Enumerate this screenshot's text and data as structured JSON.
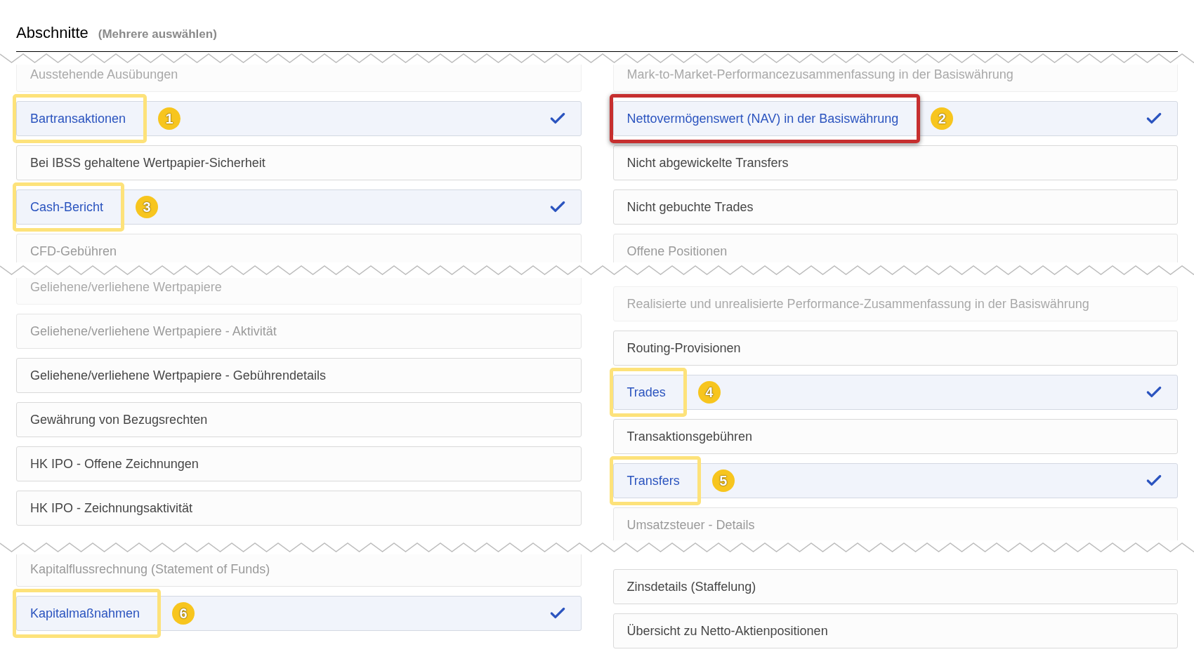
{
  "header": {
    "title": "Abschnitte",
    "hint": "(Mehrere auswählen)"
  },
  "segments": [
    {
      "columns": [
        [
          {
            "label": "Ausstehende Ausübungen",
            "selected": false,
            "kind": "faint"
          },
          {
            "label": "Bartransaktionen",
            "selected": true,
            "kind": "normal",
            "callout": {
              "number": "1",
              "color": "#fde27a"
            }
          },
          {
            "label": "Bei IBSS gehaltene Wertpapier-Sicherheit",
            "selected": false,
            "kind": "normal"
          },
          {
            "label": "Cash-Bericht",
            "selected": true,
            "kind": "normal",
            "callout": {
              "number": "3",
              "color": "#fde27a"
            }
          },
          {
            "label": "CFD-Gebühren",
            "selected": false,
            "kind": "muted"
          }
        ],
        [
          {
            "label": "Mark-to-Market-Performancezusammenfassung in der Basiswährung",
            "selected": false,
            "kind": "faint"
          },
          {
            "label": "Nettovermögenswert (NAV) in der Basiswährung",
            "selected": true,
            "kind": "normal",
            "callout": {
              "number": "2",
              "color": "#c62f2f"
            }
          },
          {
            "label": "Nicht abgewickelte Transfers",
            "selected": false,
            "kind": "normal"
          },
          {
            "label": "Nicht gebuchte Trades",
            "selected": false,
            "kind": "normal"
          },
          {
            "label": "Offene Positionen",
            "selected": false,
            "kind": "muted"
          }
        ]
      ]
    },
    {
      "columns": [
        [
          {
            "label": "Geliehene/verliehene Wertpapiere",
            "selected": false,
            "kind": "faint"
          },
          {
            "label": "Geliehene/verliehene Wertpapiere - Aktivität",
            "selected": false,
            "kind": "muted"
          },
          {
            "label": "Geliehene/verliehene Wertpapiere - Gebührendetails",
            "selected": false,
            "kind": "normal"
          },
          {
            "label": "Gewährung von Bezugsrechten",
            "selected": false,
            "kind": "normal"
          },
          {
            "label": "HK IPO - Offene Zeichnungen",
            "selected": false,
            "kind": "normal"
          },
          {
            "label": "HK IPO - Zeichnungsaktivität",
            "selected": false,
            "kind": "normal"
          }
        ],
        [
          {
            "label": "Realisierte und unrealisierte Performance-Zusammenfassung in der Basiswährung",
            "selected": false,
            "kind": "faint"
          },
          {
            "label": "Routing-Provisionen",
            "selected": false,
            "kind": "normal"
          },
          {
            "label": "Trades",
            "selected": true,
            "kind": "normal",
            "callout": {
              "number": "4",
              "color": "#fde27a"
            }
          },
          {
            "label": "Transaktionsgebühren",
            "selected": false,
            "kind": "normal"
          },
          {
            "label": "Transfers",
            "selected": true,
            "kind": "normal",
            "callout": {
              "number": "5",
              "color": "#fde27a"
            }
          },
          {
            "label": "Umsatzsteuer - Details",
            "selected": false,
            "kind": "muted"
          }
        ]
      ]
    },
    {
      "columns": [
        [
          {
            "label": "Kapitalflussrechnung (Statement of Funds)",
            "selected": false,
            "kind": "muted"
          },
          {
            "label": "Kapitalmaßnahmen",
            "selected": true,
            "kind": "normal",
            "callout": {
              "number": "6",
              "color": "#fde27a"
            }
          }
        ],
        [
          {
            "label": "Zinsdetails (Staffelung)",
            "selected": false,
            "kind": "normal"
          },
          {
            "label": "Übersicht zu Netto-Aktienpositionen",
            "selected": false,
            "kind": "normal"
          }
        ]
      ]
    }
  ]
}
